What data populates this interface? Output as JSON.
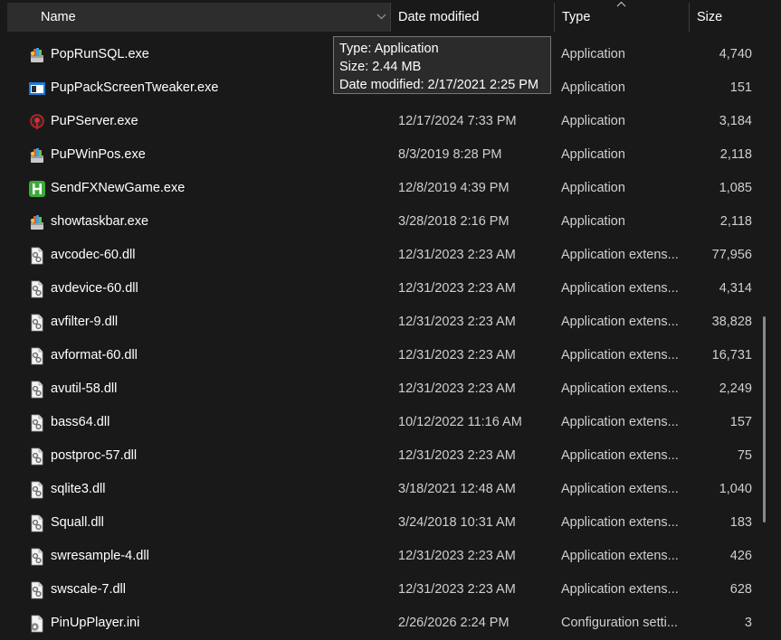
{
  "header": {
    "columns": [
      {
        "label": "Name"
      },
      {
        "label": "Date modified"
      },
      {
        "label": "Type"
      },
      {
        "label": "Size"
      }
    ],
    "sort_column": "Type",
    "sort_direction": "ascending"
  },
  "tooltip": {
    "type_line": "Type: Application",
    "size_line": "Size: 2.44 MB",
    "date_line": "Date modified: 2/17/2021 2:25 PM"
  },
  "files": [
    {
      "name": "PopRunSQL.exe",
      "date": "",
      "type": "Application",
      "size": "4,740",
      "icon": "app-installer-icon"
    },
    {
      "name": "PupPackScreenTweaker.exe",
      "date": "",
      "type": "Application",
      "size": "151",
      "icon": "window-app-icon"
    },
    {
      "name": "PuPServer.exe",
      "date": "12/17/2024 7:33 PM",
      "type": "Application",
      "size": "3,184",
      "icon": "red-ball-icon"
    },
    {
      "name": "PuPWinPos.exe",
      "date": "8/3/2019 8:28 PM",
      "type": "Application",
      "size": "2,118",
      "icon": "app-installer-icon"
    },
    {
      "name": "SendFXNewGame.exe",
      "date": "12/8/2019 4:39 PM",
      "type": "Application",
      "size": "1,085",
      "icon": "green-h-icon"
    },
    {
      "name": "showtaskbar.exe",
      "date": "3/28/2018 2:16 PM",
      "type": "Application",
      "size": "2,118",
      "icon": "app-installer-icon"
    },
    {
      "name": "avcodec-60.dll",
      "date": "12/31/2023 2:23 AM",
      "type": "Application extens...",
      "size": "77,956",
      "icon": "dll-file-icon"
    },
    {
      "name": "avdevice-60.dll",
      "date": "12/31/2023 2:23 AM",
      "type": "Application extens...",
      "size": "4,314",
      "icon": "dll-file-icon"
    },
    {
      "name": "avfilter-9.dll",
      "date": "12/31/2023 2:23 AM",
      "type": "Application extens...",
      "size": "38,828",
      "icon": "dll-file-icon"
    },
    {
      "name": "avformat-60.dll",
      "date": "12/31/2023 2:23 AM",
      "type": "Application extens...",
      "size": "16,731",
      "icon": "dll-file-icon"
    },
    {
      "name": "avutil-58.dll",
      "date": "12/31/2023 2:23 AM",
      "type": "Application extens...",
      "size": "2,249",
      "icon": "dll-file-icon"
    },
    {
      "name": "bass64.dll",
      "date": "10/12/2022 11:16 AM",
      "type": "Application extens...",
      "size": "157",
      "icon": "dll-file-icon"
    },
    {
      "name": "postproc-57.dll",
      "date": "12/31/2023 2:23 AM",
      "type": "Application extens...",
      "size": "75",
      "icon": "dll-file-icon"
    },
    {
      "name": "sqlite3.dll",
      "date": "3/18/2021 12:48 AM",
      "type": "Application extens...",
      "size": "1,040",
      "icon": "dll-file-icon"
    },
    {
      "name": "Squall.dll",
      "date": "3/24/2018 10:31 AM",
      "type": "Application extens...",
      "size": "183",
      "icon": "dll-file-icon"
    },
    {
      "name": "swresample-4.dll",
      "date": "12/31/2023 2:23 AM",
      "type": "Application extens...",
      "size": "426",
      "icon": "dll-file-icon"
    },
    {
      "name": "swscale-7.dll",
      "date": "12/31/2023 2:23 AM",
      "type": "Application extens...",
      "size": "628",
      "icon": "dll-file-icon"
    },
    {
      "name": "PinUpPlayer.ini",
      "date": "2/26/2026 2:24 PM",
      "type": "Configuration setti...",
      "size": "3",
      "icon": "settings-file-icon"
    }
  ],
  "colors": {
    "background": "#191919",
    "header_active": "#2d2d2d",
    "text_primary": "#ffffff",
    "text_secondary": "#cfcfcf",
    "tooltip_border": "#767676"
  }
}
